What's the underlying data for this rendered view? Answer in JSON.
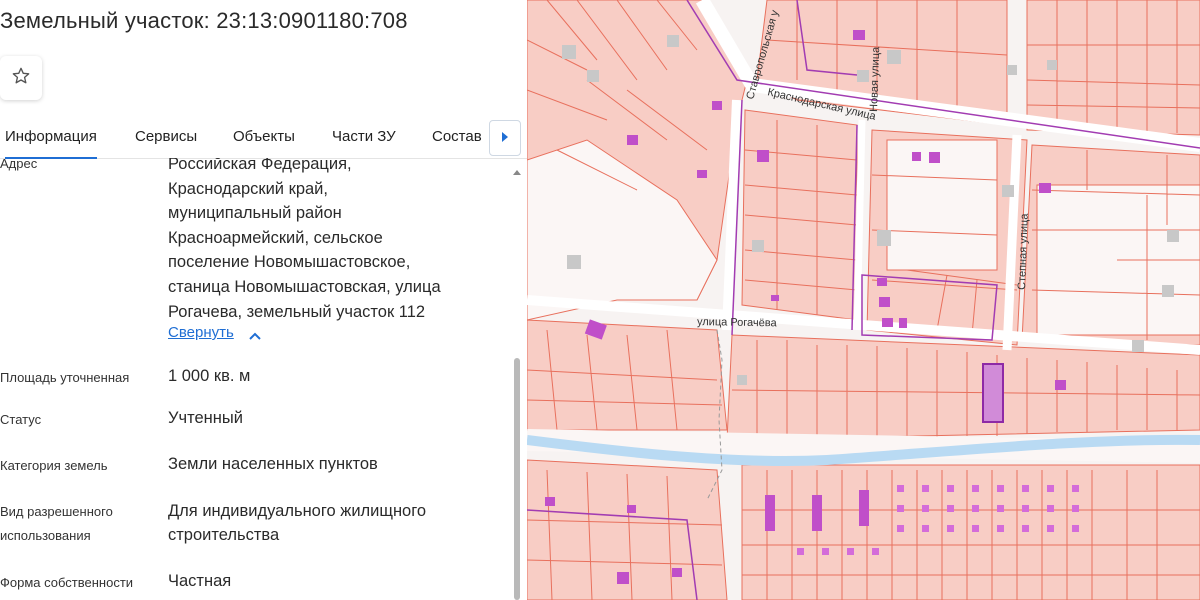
{
  "panel": {
    "title": "Земельный участок: 23:13:0901180:708",
    "favorite_icon": "star-outline-icon",
    "tabs": [
      {
        "label": "Информация",
        "active": true
      },
      {
        "label": "Сервисы",
        "active": false
      },
      {
        "label": "Объекты",
        "active": false
      },
      {
        "label": "Части ЗУ",
        "active": false
      },
      {
        "label": "Состав",
        "active": false
      }
    ],
    "tab_scroll_icon": "chevron-right-icon",
    "address": {
      "label": "Адрес",
      "lines": [
        "Российская Федерация,",
        "Краснодарский край,",
        "муниципальный район",
        "Красноармейский, сельское",
        "поселение Новомышастовское,",
        "станица Новомышастовская, улица",
        "Рогачева, земельный участок 112"
      ],
      "collapse_label": "Свернуть",
      "collapse_icon": "chevron-up-icon"
    },
    "fields": [
      {
        "label": "Площадь уточненная",
        "value": "1 000 кв. м"
      },
      {
        "label": "Статус",
        "value": "Учтенный"
      },
      {
        "label": "Категория земель",
        "value": "Земли населенных пунктов"
      },
      {
        "label_lines": [
          "Вид разрешенного",
          "использования"
        ],
        "value_lines": [
          "Для индивидуального жилищного",
          "строительства"
        ]
      },
      {
        "label": "Форма собственности",
        "value": "Частная"
      }
    ]
  },
  "map": {
    "streets": [
      "Ставропольская у",
      "Краснодарская улица",
      "Новая улица",
      "Степная улица",
      "улица Рогачёва"
    ],
    "colors": {
      "background": "#f7f3f2",
      "parcel_fill": "#f8cdc5",
      "parcel_stroke": "#e8705d",
      "road": "#ffffff",
      "river": "#b9daf3",
      "building": "#c04fc9",
      "building_gray": "#c8c8c8",
      "selected_stroke": "#8e2aa6",
      "accent": "#1f6ed4"
    }
  }
}
